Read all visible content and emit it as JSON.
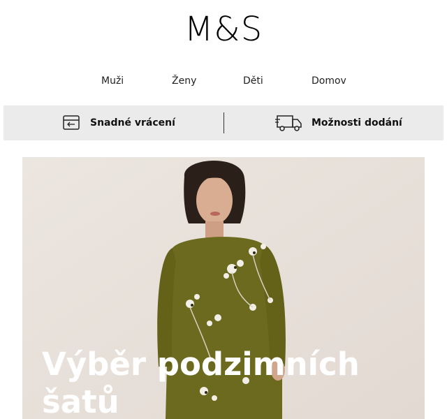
{
  "brand": {
    "logo_text": "M&S"
  },
  "nav": {
    "items": [
      "Muži",
      "Ženy",
      "Děti",
      "Domov"
    ]
  },
  "banner": {
    "returns_label": "Snadné vrácení",
    "returns_icon": "return-parcel-icon",
    "delivery_label": "Možnosti dodání",
    "delivery_icon": "delivery-truck-icon"
  },
  "hero": {
    "title": "Výběr podzimních šatů",
    "image": "model-in-olive-floral-dress"
  },
  "colors": {
    "banner_bg": "#ebebeb",
    "hero_bg": "#e9e2dc",
    "dress": "#6b6a1e",
    "title_text": "#ffffff"
  }
}
